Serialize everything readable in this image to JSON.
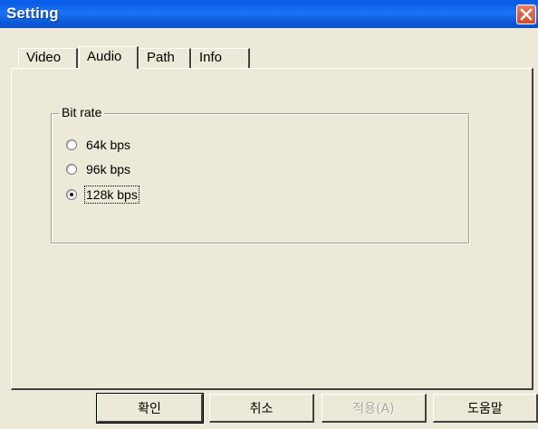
{
  "window": {
    "title": "Setting"
  },
  "tabs": [
    {
      "label": "Video",
      "active": false
    },
    {
      "label": "Audio",
      "active": true
    },
    {
      "label": "Path",
      "active": false
    },
    {
      "label": "Info",
      "active": false
    }
  ],
  "bitrate_group": {
    "title": "Bit rate",
    "options": [
      {
        "label": "64k bps",
        "checked": false
      },
      {
        "label": "96k bps",
        "checked": false
      },
      {
        "label": "128k bps",
        "checked": true
      }
    ]
  },
  "buttons": {
    "ok": "확인",
    "cancel": "취소",
    "apply": "적용(A)",
    "help": "도움말"
  },
  "colors": {
    "titlebar": "#0a5fe8",
    "dialog_bg": "#ece9d8",
    "close_red": "#d44a27"
  }
}
